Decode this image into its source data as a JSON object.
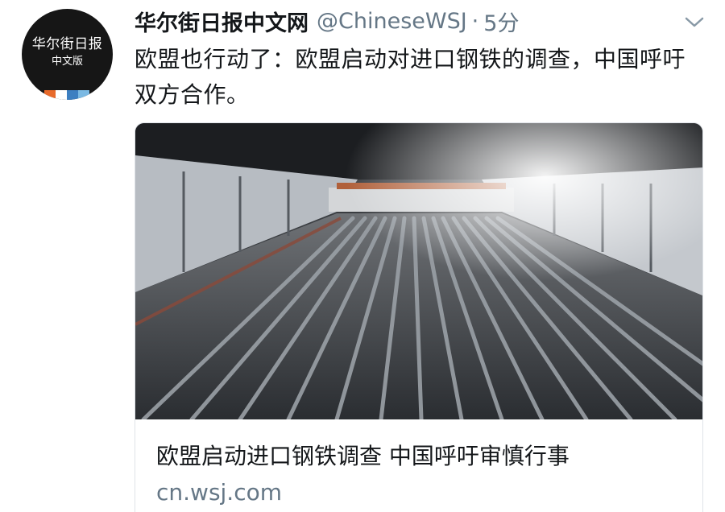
{
  "avatar": {
    "line1": "华尔街日报",
    "line2": "中文版",
    "stripe_colors": [
      "#e86a2b",
      "#ffffff",
      "#3d7fc1",
      "#7bb9e3"
    ]
  },
  "tweet": {
    "author_name": "华尔街日报中文网",
    "handle": "@ChineseWSJ",
    "separator": "·",
    "time": "5分",
    "text": "欧盟也行动了：欧盟启动对进口钢铁的调查，中国呼吁双方合作。"
  },
  "menu": {
    "icon": "chevron-down-icon"
  },
  "card": {
    "title": "欧盟启动进口钢铁调查 中国呼吁审慎行事",
    "domain": "cn.wsj.com",
    "image_subject": "steel-bars-factory-photo"
  },
  "colors": {
    "text": "#14171a",
    "secondary": "#657786",
    "border": "#dfe3e8"
  }
}
